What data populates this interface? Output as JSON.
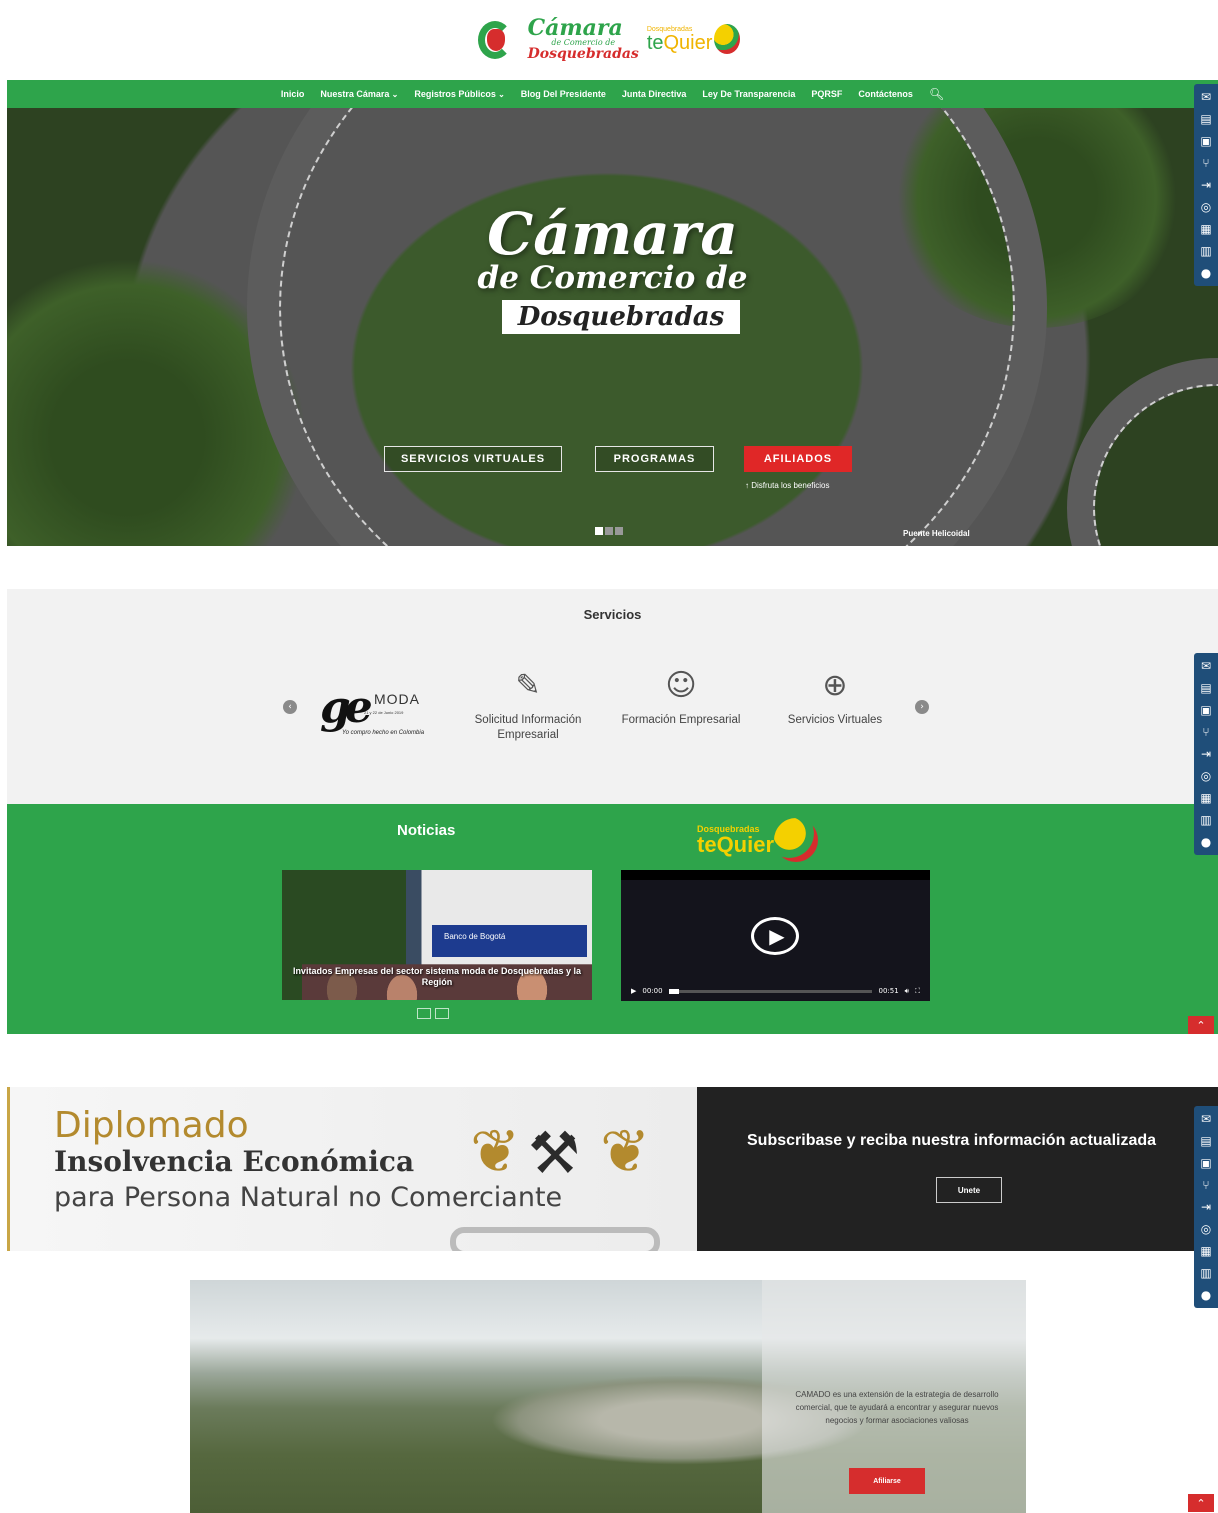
{
  "header": {
    "logo_title": "Cámara",
    "logo_sub": "de Comercio de",
    "logo_city": "Dosquebradas",
    "tq_small": "Dosquebradas",
    "tq_big_a": "te",
    "tq_big_b": "Quier"
  },
  "nav": {
    "items": [
      "Inicio",
      "Nuestra Cámara",
      "Registros Públicos",
      "Blog Del Presidente",
      "Junta Directiva",
      "Ley De Transparencia",
      "PQRSF",
      "Contáctenos"
    ]
  },
  "hero": {
    "title1": "Cámara",
    "title2": "de Comercio de",
    "title3": "Dosquebradas",
    "btn_servicios": "SERVICIOS VIRTUALES",
    "btn_programas": "PROGRAMAS",
    "btn_afiliados": "AFILIADOS",
    "afiliados_sub": "Disfruta los beneficios",
    "caption": "Puente Helicoidal"
  },
  "servicios": {
    "title": "Servicios",
    "moda": {
      "mo": "MODA",
      "small": "21 y 22 de Junio 2019",
      "slogan": "Yo compro hecho en Colombia"
    },
    "items": [
      {
        "label": "Solicitud Información Empresarial",
        "icon": "edit-document-icon"
      },
      {
        "label": "Formación Empresarial",
        "icon": "person-tie-icon"
      },
      {
        "label": "Servicios Virtuales",
        "icon": "globe-icon"
      }
    ]
  },
  "noticias": {
    "title": "Noticias",
    "bank": "Banco de Bogotá",
    "caption": "Invitados Empresas del sector sistema moda de Dosquebradas y la Región",
    "video_time_current": "00:00",
    "video_time_total": "00:51"
  },
  "diplomado": {
    "line1": "Diplomado",
    "line2": "Insolvencia Económica",
    "line3": "para Persona Natural no Comerciante"
  },
  "subscribe": {
    "text": "Subscribase y reciba nuestra información actualizada",
    "button": "Unete"
  },
  "camado": {
    "text": "CAMADO es una extensión de la estrategia de desarrollo comercial, que te ayudará a encontrar y asegurar nuevos negocios y formar asociaciones valiosas",
    "button": "Afiliarse"
  },
  "colors": {
    "green": "#2ea44b",
    "red": "#d62d2d",
    "sidebar_blue": "#1f4e79",
    "dark": "#222222"
  },
  "sidebar_icons": [
    "chat-icon",
    "document-icon",
    "computer-icon",
    "network-icon",
    "login-icon",
    "database-icon",
    "calendar-icon",
    "table-icon",
    "comment-icon"
  ]
}
